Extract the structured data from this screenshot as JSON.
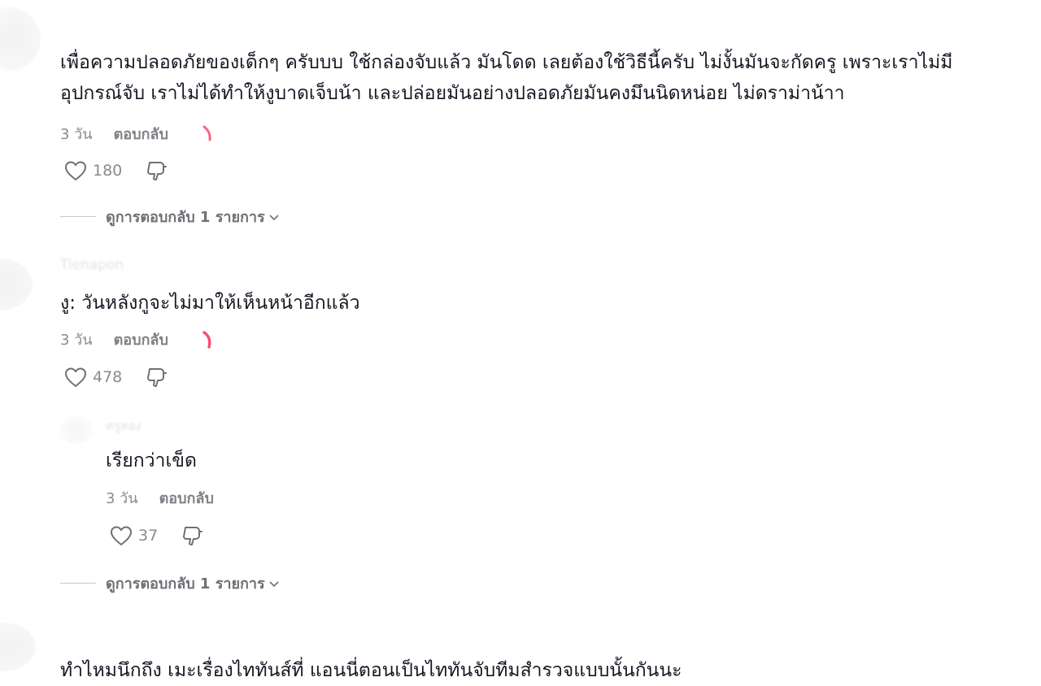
{
  "comments": [
    {
      "text_line1": "เพื่อความปลอดภัยของเด็กๆ ครับบบ ใช้กล่องจับแล้ว มันโดด เลยต้องใช้วิธีนี้ครับ ไม่งั้นมันจะกัดครู เพราะเราไม่มี",
      "text_line2": "อุปกรณ์จับ เราไม่ได้ทำให้งูบาดเจ็บน้า และปล่อยมันอย่างปลอดภัยมันคงมึนนิดหน่อย ไม่ดราม่าน้าา",
      "time": "3 วัน",
      "reply_label": "ตอบกลับ",
      "likes": "180",
      "view_replies": "ดูการตอบกลับ 1 รายการ"
    },
    {
      "username": "Tienapon",
      "text": "งู: วันหลังกูจะไม่มาให้เห็นหน้าอีกแล้ว",
      "time": "3 วัน",
      "reply_label": "ตอบกลับ",
      "likes": "478",
      "reply": {
        "username": "ครูสอง",
        "text": "เรียกว่าเข็ด",
        "time": "3 วัน",
        "reply_label": "ตอบกลับ",
        "likes": "37"
      },
      "view_replies": "ดูการตอบกลับ 1 รายการ"
    },
    {
      "text": "ทำไหมนึกถึง เมะเรื่องไททันส์ที่ แอนนี่ตอนเป็นไททันจับทีมสำรวจแบบนั้นกันนะ"
    }
  ],
  "icons": {
    "like": "heart-outline-icon",
    "dislike": "thumbs-down-icon",
    "expand": "chevron-down-icon",
    "creator_like": "heart-emoji-icon"
  },
  "colors": {
    "text": "#161823",
    "meta": "#8a8b91",
    "accent_heart": "#fe2c55"
  }
}
